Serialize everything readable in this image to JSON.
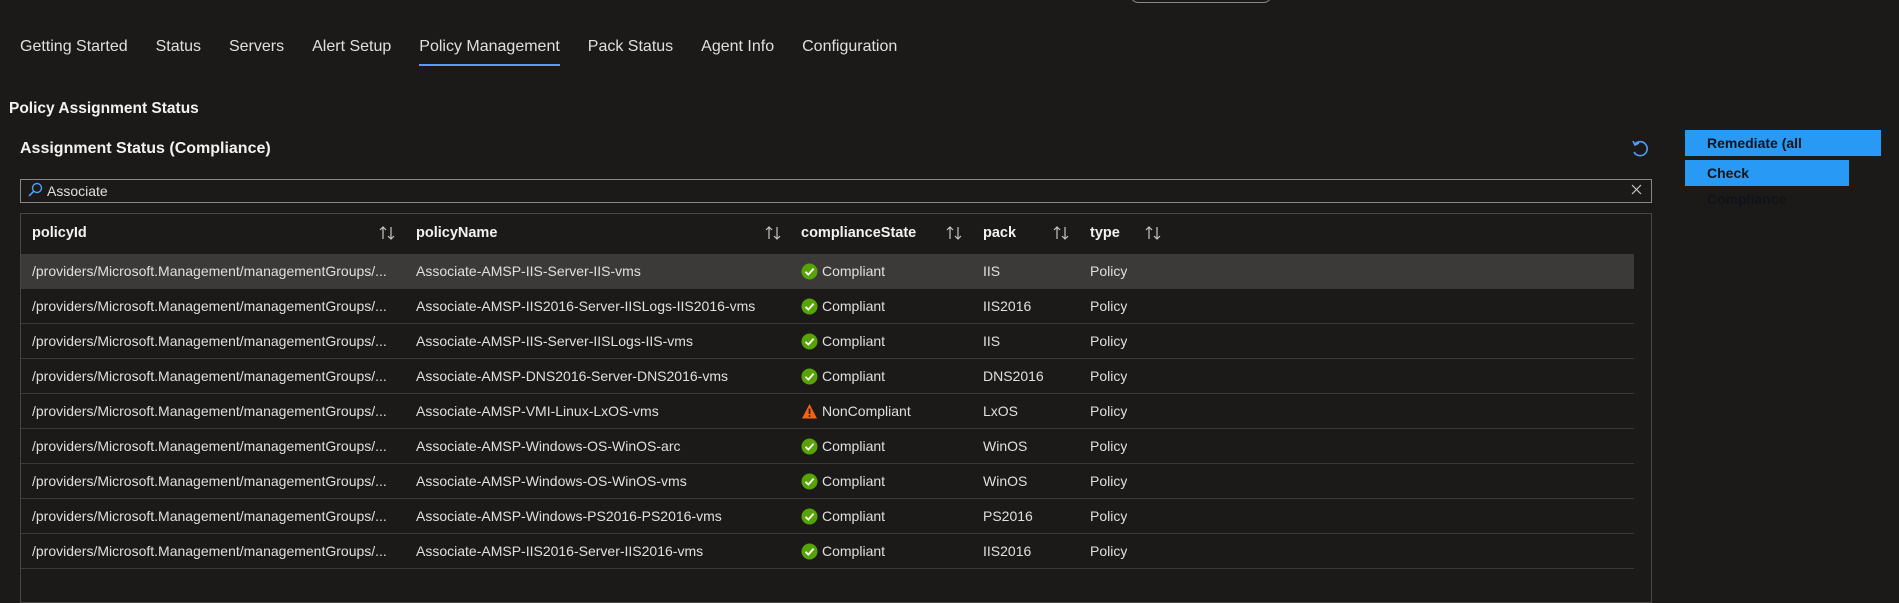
{
  "tabs": [
    {
      "label": "Getting Started"
    },
    {
      "label": "Status"
    },
    {
      "label": "Servers"
    },
    {
      "label": "Alert Setup"
    },
    {
      "label": "Policy Management",
      "active": true
    },
    {
      "label": "Pack Status"
    },
    {
      "label": "Agent Info"
    },
    {
      "label": "Configuration"
    }
  ],
  "section_title": "Policy Assignment Status",
  "grid_title": "Assignment Status (Compliance)",
  "buttons": {
    "remediate": "Remediate (all policies)",
    "check": "Check Compliance"
  },
  "search": {
    "value": "Associate"
  },
  "columns": [
    "policyId",
    "policyName",
    "complianceState",
    "pack",
    "type"
  ],
  "rows": [
    {
      "policyId": "/providers/Microsoft.Management/managementGroups/...",
      "policyName": "Associate-AMSP-IIS-Server-IIS-vms",
      "complianceState": "Compliant",
      "pack": "IIS",
      "type": "Policy",
      "status_icon": "check-circle-icon"
    },
    {
      "policyId": "/providers/Microsoft.Management/managementGroups/...",
      "policyName": "Associate-AMSP-IIS2016-Server-IISLogs-IIS2016-vms",
      "complianceState": "Compliant",
      "pack": "IIS2016",
      "type": "Policy",
      "status_icon": "check-circle-icon"
    },
    {
      "policyId": "/providers/Microsoft.Management/managementGroups/...",
      "policyName": "Associate-AMSP-IIS-Server-IISLogs-IIS-vms",
      "complianceState": "Compliant",
      "pack": "IIS",
      "type": "Policy",
      "status_icon": "check-circle-icon"
    },
    {
      "policyId": "/providers/Microsoft.Management/managementGroups/...",
      "policyName": "Associate-AMSP-DNS2016-Server-DNS2016-vms",
      "complianceState": "Compliant",
      "pack": "DNS2016",
      "type": "Policy",
      "status_icon": "check-circle-icon"
    },
    {
      "policyId": "/providers/Microsoft.Management/managementGroups/...",
      "policyName": "Associate-AMSP-VMI-Linux-LxOS-vms",
      "complianceState": "NonCompliant",
      "pack": "LxOS",
      "type": "Policy",
      "status_icon": "warning-icon"
    },
    {
      "policyId": "/providers/Microsoft.Management/managementGroups/...",
      "policyName": "Associate-AMSP-Windows-OS-WinOS-arc",
      "complianceState": "Compliant",
      "pack": "WinOS",
      "type": "Policy",
      "status_icon": "check-circle-icon"
    },
    {
      "policyId": "/providers/Microsoft.Management/managementGroups/...",
      "policyName": "Associate-AMSP-Windows-OS-WinOS-vms",
      "complianceState": "Compliant",
      "pack": "WinOS",
      "type": "Policy",
      "status_icon": "check-circle-icon"
    },
    {
      "policyId": "/providers/Microsoft.Management/managementGroups/...",
      "policyName": "Associate-AMSP-Windows-PS2016-PS2016-vms",
      "complianceState": "Compliant",
      "pack": "PS2016",
      "type": "Policy",
      "status_icon": "check-circle-icon"
    },
    {
      "policyId": "/providers/Microsoft.Management/managementGroups/...",
      "policyName": "Associate-AMSP-IIS2016-Server-IIS2016-vms",
      "complianceState": "Compliant",
      "pack": "IIS2016",
      "type": "Policy",
      "status_icon": "check-circle-icon"
    }
  ],
  "colors": {
    "background": "#1b1a19",
    "accent": "#2899f5",
    "tab_underline": "#4f9ef8",
    "compliant": "#57a300",
    "noncompliant": "#f7630c",
    "selected_row": "#3b3a39"
  }
}
